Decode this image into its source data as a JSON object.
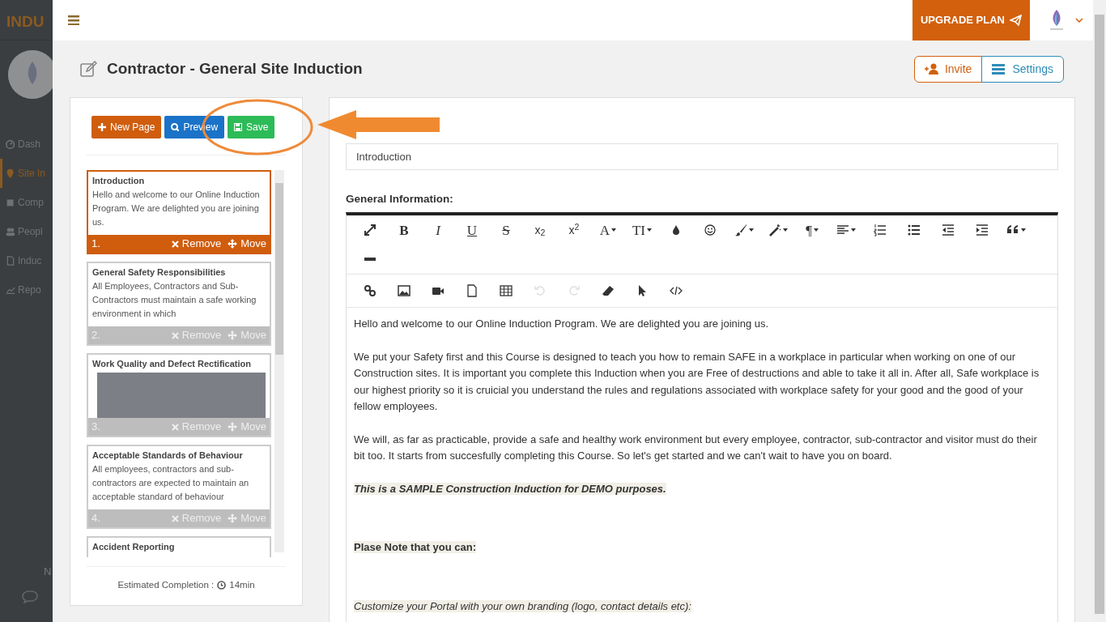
{
  "sidebar": {
    "logo_text": "INDU",
    "items": [
      {
        "label": "Dash",
        "kind": "dashboard",
        "selected": false
      },
      {
        "label": "Site In",
        "kind": "pin",
        "selected": true
      },
      {
        "label": "Comp",
        "kind": "building",
        "selected": false
      },
      {
        "label": "Peopl",
        "kind": "people",
        "selected": false
      },
      {
        "label": "Induc",
        "kind": "document",
        "selected": false
      },
      {
        "label": "Repo",
        "kind": "chart",
        "selected": false
      }
    ],
    "footer_text": "N"
  },
  "topbar": {
    "upgrade_button": "UPGRADE PLAN"
  },
  "page_title": "Contractor - General Site Induction",
  "header_buttons": [
    {
      "label": "Invite",
      "kind": "invite"
    },
    {
      "label": "Settings",
      "kind": "settings"
    }
  ],
  "page_actions": [
    {
      "label": "New Page",
      "kind": "new"
    },
    {
      "label": "Preview",
      "kind": "preview"
    },
    {
      "label": "Save",
      "kind": "save"
    }
  ],
  "pages": [
    {
      "number": "1.",
      "title": "Introduction",
      "kind": "text",
      "excerpt": "Hello and welcome to our Online Induction Program. We are delighted you are joining us.",
      "selected": true,
      "remove": "Remove",
      "move": "Move"
    },
    {
      "number": "2.",
      "title": "General Safety Responsibilities",
      "kind": "text",
      "excerpt": "All Employees, Contractors and Sub-Contractors must maintain a safe working environment in which",
      "selected": false,
      "remove": "Remove",
      "move": "Move"
    },
    {
      "number": "3.",
      "title": "Work Quality and Defect Rectification",
      "kind": "image",
      "selected": false,
      "remove": "Remove",
      "move": "Move"
    },
    {
      "number": "4.",
      "title": "Acceptable Standards of Behaviour",
      "kind": "text",
      "excerpt": "All employees, contractors and sub-contractors are expected to maintain an acceptable standard of behaviour",
      "selected": false,
      "remove": "Remove",
      "move": "Move"
    },
    {
      "title": "Accident Reporting",
      "kind": "cut",
      "selected": false
    }
  ],
  "estimated_completion": {
    "label": "Estimated Completion :",
    "value": "14min"
  },
  "editor": {
    "title_value": "Introduction",
    "section_label": "General Information:",
    "toolbar": [
      {
        "kind": "fullscreen",
        "dropdown": false,
        "disabled": false
      },
      {
        "kind": "bold",
        "label": "B",
        "dropdown": false,
        "disabled": false
      },
      {
        "kind": "italic",
        "label": "I",
        "dropdown": false,
        "disabled": false
      },
      {
        "kind": "underline",
        "label": "U",
        "dropdown": false,
        "disabled": false
      },
      {
        "kind": "strike",
        "label": "S",
        "dropdown": false,
        "disabled": false
      },
      {
        "kind": "script",
        "label": "x$_{2}$",
        "dropdown": false,
        "disabled": false
      },
      {
        "kind": "script",
        "label": "x$^{2}$",
        "dropdown": false,
        "disabled": false
      },
      {
        "kind": "serif",
        "label": "A",
        "dropdown": true,
        "disabled": false
      },
      {
        "kind": "serif",
        "label": "TI",
        "dropdown": true,
        "disabled": false
      },
      {
        "kind": "droplet",
        "dropdown": false,
        "disabled": false
      },
      {
        "kind": "smiley",
        "dropdown": false,
        "disabled": false
      },
      {
        "kind": "brush",
        "dropdown": true,
        "disabled": false
      },
      {
        "kind": "wand",
        "dropdown": true,
        "disabled": false
      },
      {
        "kind": "serif",
        "label": "¶",
        "dropdown": true,
        "disabled": false
      },
      {
        "kind": "align",
        "dropdown": true,
        "disabled": false
      },
      {
        "kind": "ordered-list",
        "dropdown": false,
        "disabled": false
      },
      {
        "kind": "bullet-list",
        "dropdown": false,
        "disabled": false
      },
      {
        "kind": "outdent",
        "dropdown": false,
        "disabled": false
      },
      {
        "kind": "indent",
        "dropdown": false,
        "disabled": false
      },
      {
        "kind": "quote",
        "dropdown": true,
        "disabled": false
      },
      {
        "kind": "rule",
        "dropdown": false,
        "disabled": false
      }
    ],
    "toolbar_2": [
      {
        "kind": "link",
        "dropdown": false,
        "disabled": false
      },
      {
        "kind": "image",
        "dropdown": false,
        "disabled": false
      },
      {
        "kind": "video",
        "dropdown": false,
        "disabled": false
      },
      {
        "kind": "file",
        "dropdown": false,
        "disabled": false
      },
      {
        "kind": "table",
        "dropdown": false,
        "disabled": false
      },
      {
        "kind": "undo",
        "dropdown": false,
        "disabled": true
      },
      {
        "kind": "redo",
        "dropdown": false,
        "disabled": true
      },
      {
        "kind": "eraser",
        "dropdown": false,
        "disabled": false
      },
      {
        "kind": "pointer",
        "dropdown": false,
        "disabled": false
      },
      {
        "kind": "code",
        "dropdown": false,
        "disabled": false
      }
    ],
    "content": [
      {
        "kind": "paragraph",
        "text": "Hello and welcome to our Online Induction Program. We are delighted you are joining us."
      },
      {
        "kind": "paragraph",
        "text": "We put your Safety first and this Course is designed to teach you how to remain SAFE in a workplace in particular when working on one of our Construction sites. It is important you complete this Induction when you are Free of destructions and able to take it all in. After all, Safe workplace is our highest priority so it is cruicial you understand the rules and regulations associated with workplace safety for your good and the good of your fellow employees."
      },
      {
        "kind": "paragraph",
        "text": "We will, as far as practicable, provide a safe and healthy work environment but every employee, contractor, sub-contractor and visitor must do their bit too. It starts from succesfully completing this Course. So let's get started and we can't wait to have you on board."
      },
      {
        "kind": "emphasis",
        "text": "This is a SAMPLE Construction Induction for DEMO purposes."
      },
      {
        "kind": "heading",
        "text": "Plase Note that you can:"
      },
      {
        "kind": "aside",
        "text": "Customize your Portal with your own branding (logo, contact details etc):"
      }
    ]
  }
}
